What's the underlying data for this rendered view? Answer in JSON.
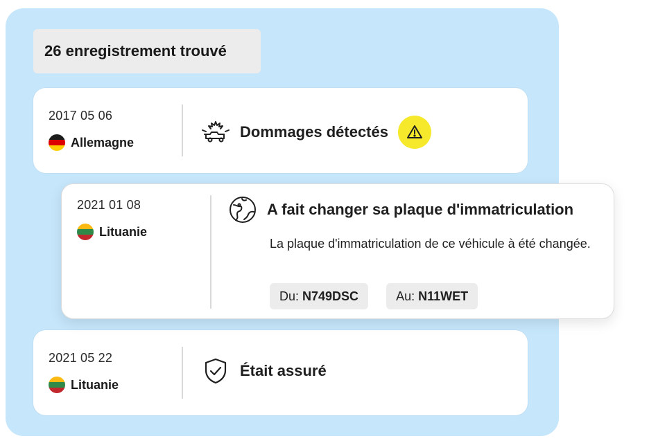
{
  "summary": {
    "records_found": "26 enregistrement trouvé"
  },
  "records": [
    {
      "date": "2017 05 06",
      "country": "Allemagne",
      "flag_colors": [
        "#1c1c1c",
        "#dd0000",
        "#ffce00"
      ],
      "event_icon": "car-crash-icon",
      "title": "Dommages détectés",
      "badge_icon": "warning-icon",
      "badge_color": "#f6e92b"
    },
    {
      "date": "2021 01 08",
      "country": "Lituanie",
      "flag_colors": [
        "#fdb913",
        "#2f8a4a",
        "#c1272d"
      ],
      "event_icon": "globe-location-icon",
      "title": "A fait changer sa plaque d'immatriculation",
      "description": "La plaque d'immatriculation de ce véhicule à été changée.",
      "from_label": "Du:",
      "from_value": "N749DSC",
      "to_label": "Au:",
      "to_value": "N11WET"
    },
    {
      "date": "2021 05 22",
      "country": "Lituanie",
      "flag_colors": [
        "#fdb913",
        "#2f8a4a",
        "#c1272d"
      ],
      "event_icon": "shield-check-icon",
      "title": "Était assuré"
    }
  ],
  "colors": {
    "panel_background": "#c6e6fb",
    "card_background": "#ffffff",
    "chip_background": "#ececec"
  }
}
